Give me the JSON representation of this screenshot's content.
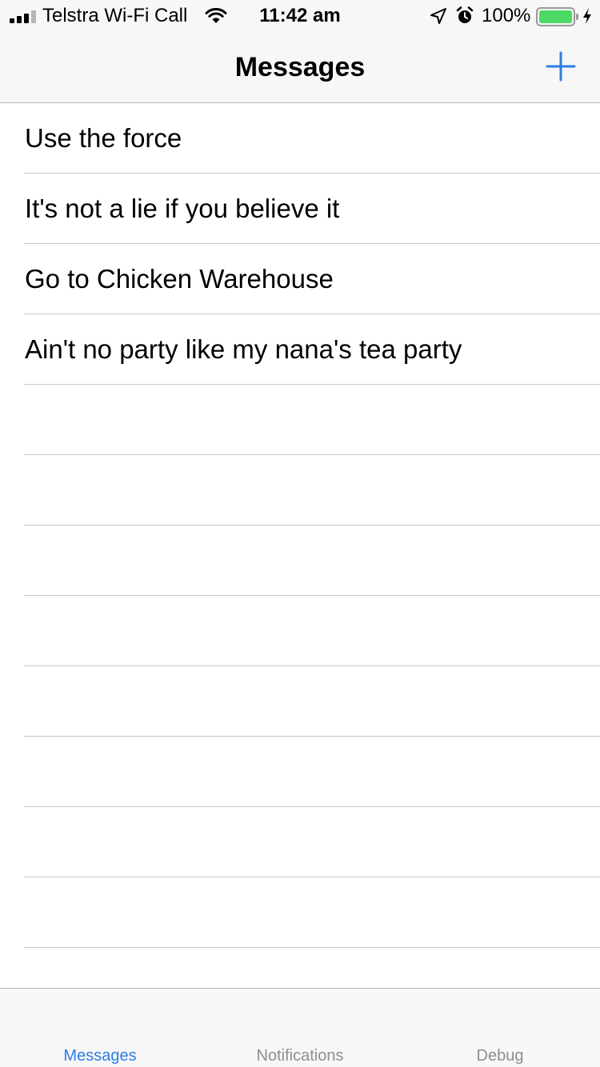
{
  "status_bar": {
    "carrier": "Telstra Wi-Fi Call",
    "time": "11:42 am",
    "battery_percent": "100%",
    "battery_level": 1.0,
    "signal_icon": "cellular-signal-icon",
    "wifi_icon": "wifi-icon",
    "location_icon": "location-arrow-icon",
    "alarm_icon": "alarm-clock-icon",
    "battery_icon": "battery-icon",
    "charging_icon": "charging-bolt-icon"
  },
  "nav": {
    "title": "Messages",
    "add_icon": "plus-icon"
  },
  "messages": [
    "Use the force",
    "It's not a lie if you believe it",
    "Go to Chicken Warehouse",
    "Ain't no party like my nana's tea party",
    "",
    "",
    "",
    "",
    "",
    "",
    "",
    "",
    ""
  ],
  "tabs": [
    {
      "label": "Messages",
      "active": true
    },
    {
      "label": "Notifications",
      "active": false
    },
    {
      "label": "Debug",
      "active": false
    }
  ],
  "colors": {
    "accent": "#2f7de1",
    "battery_fill": "#4cd964",
    "inactive_tab": "#8e8e93",
    "separator": "#c8c7cc",
    "bar_background": "#f7f7f7"
  }
}
